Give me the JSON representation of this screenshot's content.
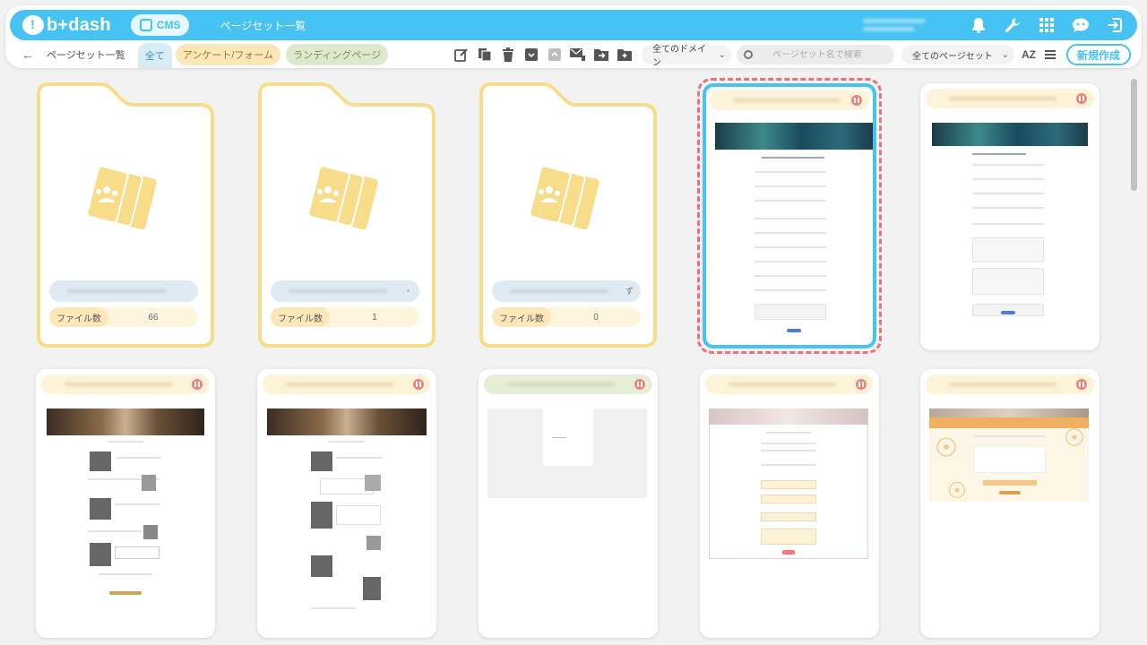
{
  "header": {
    "logo": "b+dash",
    "cms_label": "CMS",
    "title": "ページセット一覧",
    "icons": [
      "bell-icon",
      "wrench-icon",
      "grid-icon",
      "chat-bot-icon",
      "logout-icon"
    ]
  },
  "toolbar": {
    "back_icon": "←",
    "breadcrumb": "ページセット一覧",
    "tabs": [
      "全て",
      "アンケート/フォーム",
      "ランディングページ"
    ],
    "tool_icons": [
      "edit-icon",
      "copy-icon",
      "trash-icon",
      "archive-icon",
      "unarchive-icon",
      "mail-icon",
      "move-folder-icon",
      "add-folder-icon"
    ],
    "domain_select": "全てのドメイン",
    "search_placeholder": "ページセット名で検索",
    "pageset_select": "全てのページセット",
    "sort_label": "AZ",
    "new_button": "新規作成"
  },
  "folders": [
    {
      "count_label": "ファイル数",
      "count": "66",
      "suffix": ""
    },
    {
      "count_label": "ファイル数",
      "count": "1",
      "suffix": "・"
    },
    {
      "count_label": "ファイル数",
      "count": "0",
      "suffix": "ず"
    }
  ],
  "colors": {
    "accent": "#46c3f2",
    "folder_yellow": "#f7dc8a",
    "selected_dash": "#ef6f7a",
    "status_paused": "#f0827e"
  }
}
